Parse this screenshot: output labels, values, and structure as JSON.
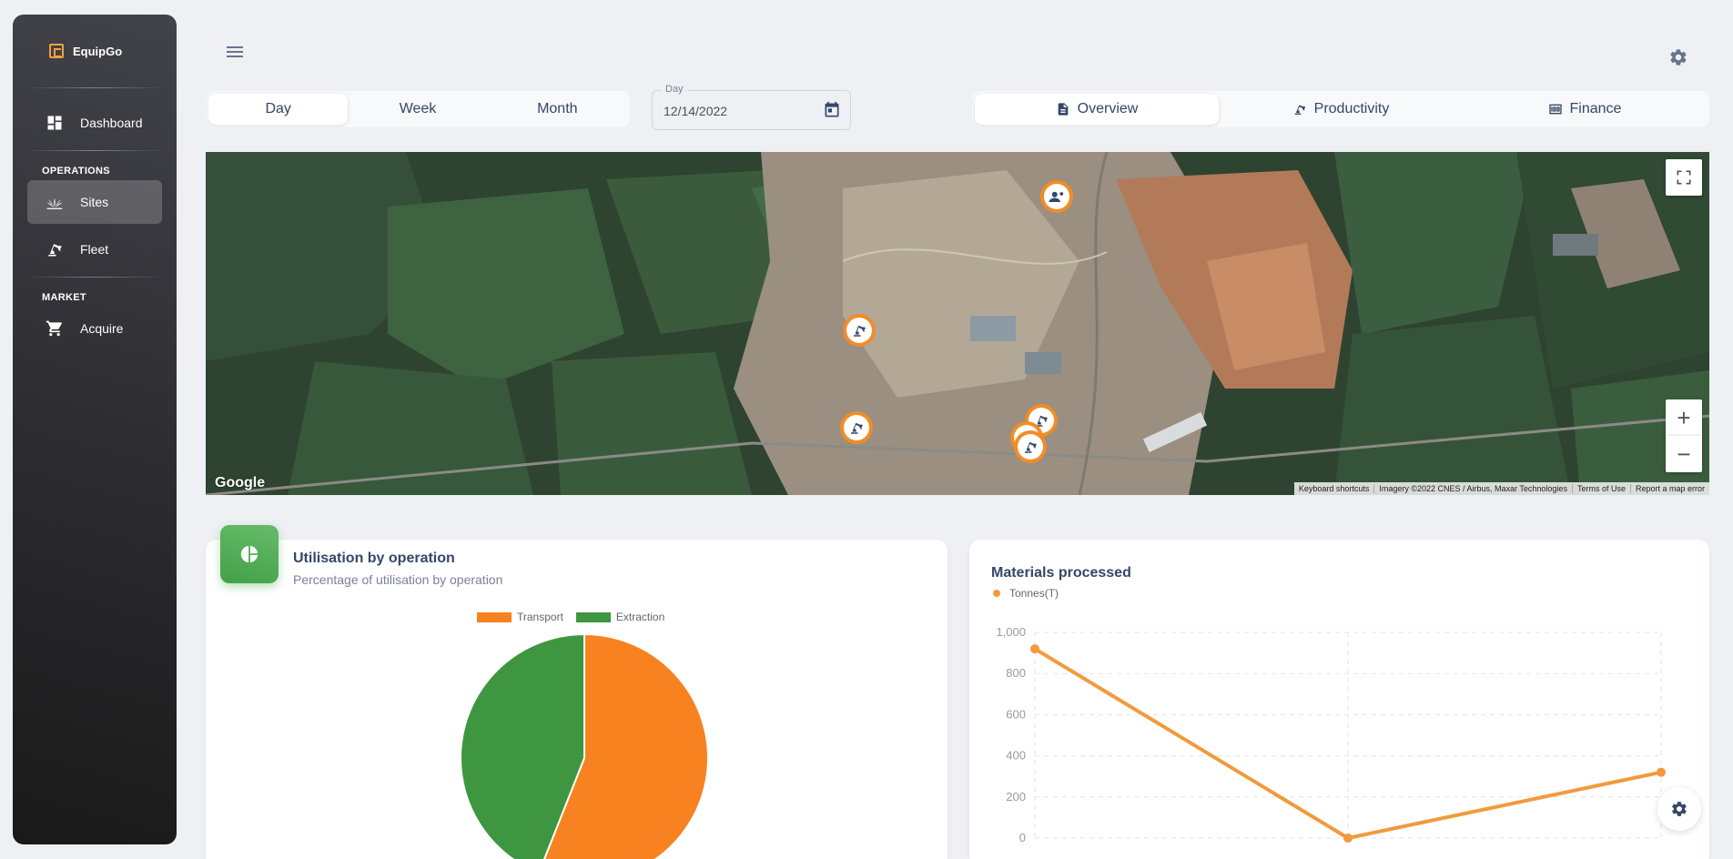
{
  "app": {
    "name": "EquipGo"
  },
  "sidebar": {
    "dashboard_label": "Dashboard",
    "operations_label": "OPERATIONS",
    "sites_label": "Sites",
    "fleet_label": "Fleet",
    "market_label": "MARKET",
    "acquire_label": "Acquire"
  },
  "period_tabs": [
    {
      "label": "Day",
      "active": true
    },
    {
      "label": "Week",
      "active": false
    },
    {
      "label": "Month",
      "active": false
    }
  ],
  "date_field": {
    "label": "Day",
    "value": "12/14/2022"
  },
  "view_tabs": [
    {
      "label": "Overview",
      "icon": "document-icon",
      "active": true
    },
    {
      "label": "Productivity",
      "icon": "excavator-icon",
      "active": false
    },
    {
      "label": "Finance",
      "icon": "money-icon",
      "active": false
    }
  ],
  "map": {
    "logo": "Google",
    "attribution": {
      "shortcuts": "Keyboard shortcuts",
      "imagery": "Imagery ©2022 CNES / Airbus, Maxar Technologies",
      "terms": "Terms of Use",
      "report": "Report a map error"
    },
    "markers": [
      "worker-icon",
      "excavator-icon",
      "excavator-icon",
      "excavator-icon",
      "excavator-icon",
      "excavator-icon"
    ]
  },
  "utilisation_card": {
    "title": "Utilisation by operation",
    "subtitle": "Percentage of utilisation by operation"
  },
  "materials_card": {
    "title": "Materials processed"
  },
  "chart_data": [
    {
      "type": "pie",
      "title": "Utilisation by operation",
      "categories": [
        "Transport",
        "Extraction"
      ],
      "values": [
        56,
        44
      ],
      "colors": [
        "#f7821f",
        "#3f9641"
      ],
      "legend": "top"
    },
    {
      "type": "line",
      "title": "Materials processed",
      "series": [
        {
          "name": "Tonnes(T)",
          "values": [
            920,
            0,
            320
          ],
          "color": "#f29a3c"
        }
      ],
      "x": [
        0,
        1,
        2
      ],
      "ylim": [
        0,
        1000
      ],
      "yticks": [
        "0",
        "200",
        "400",
        "600",
        "800",
        "1,000"
      ],
      "grid": true,
      "legend": "top-left"
    }
  ]
}
